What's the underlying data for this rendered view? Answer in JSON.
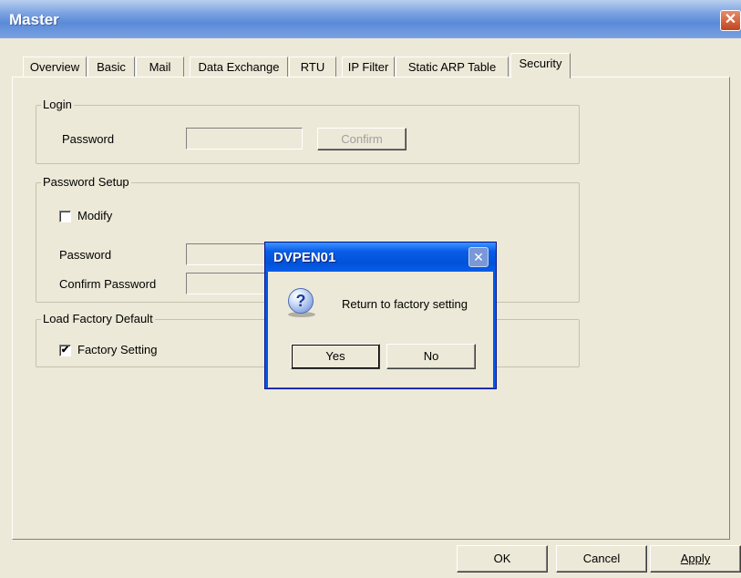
{
  "window": {
    "title": "Master",
    "close_label": "✕"
  },
  "tabs": [
    {
      "label": "Overview"
    },
    {
      "label": "Basic"
    },
    {
      "label": "Mail"
    },
    {
      "label": "Data Exchange"
    },
    {
      "label": "RTU"
    },
    {
      "label": "IP Filter"
    },
    {
      "label": "Static ARP Table"
    },
    {
      "label": "Security"
    }
  ],
  "active_tab": "Security",
  "login": {
    "title": "Login",
    "password_label": "Password",
    "password_value": "",
    "confirm_label": "Confirm"
  },
  "password_setup": {
    "title": "Password Setup",
    "modify_label": "Modify",
    "modify_checked": false,
    "password_label": "Password",
    "confirm_password_label": "Confirm Password"
  },
  "load_factory_default": {
    "title": "Load Factory Default",
    "factory_setting_label": "Factory Setting",
    "factory_setting_checked": true,
    "check_mark": "✔"
  },
  "bottom_buttons": {
    "ok_label": "OK",
    "cancel_label": "Cancel",
    "apply_label": "Apply"
  },
  "dialog": {
    "title": "DVPEN01",
    "close_label": "✕",
    "icon": "question-icon",
    "icon_glyph": "?",
    "message": "Return to factory setting",
    "yes_label": "Yes",
    "no_label": "No"
  }
}
